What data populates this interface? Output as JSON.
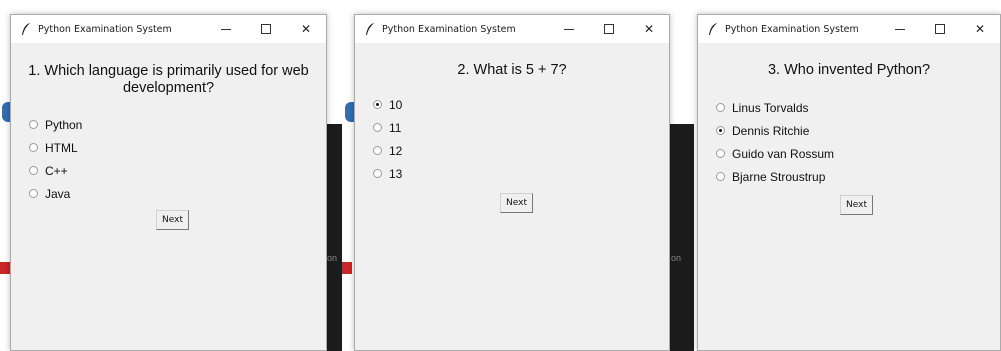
{
  "windows": [
    {
      "title": "Python Examination System",
      "question": "1. Which language is primarily used for web development?",
      "options": [
        {
          "label": "Python",
          "selected": false
        },
        {
          "label": "HTML",
          "selected": false
        },
        {
          "label": "C++",
          "selected": false
        },
        {
          "label": "Java",
          "selected": false
        }
      ],
      "next_label": "Next"
    },
    {
      "title": "Python Examination System",
      "question": "2. What is 5 + 7?",
      "options": [
        {
          "label": "10",
          "selected": true
        },
        {
          "label": "11",
          "selected": false
        },
        {
          "label": "12",
          "selected": false
        },
        {
          "label": "13",
          "selected": false
        }
      ],
      "next_label": "Next"
    },
    {
      "title": "Python Examination System",
      "question": "3. Who invented Python?",
      "options": [
        {
          "label": "Linus Torvalds",
          "selected": false
        },
        {
          "label": "Dennis Ritchie",
          "selected": true
        },
        {
          "label": "Guido van Rossum",
          "selected": false
        },
        {
          "label": "Bjarne Stroustrup",
          "selected": false
        }
      ],
      "next_label": "Next"
    }
  ],
  "controls": {
    "minimize": "—",
    "maximize": "☐",
    "close": "✕"
  },
  "background_fragments": {
    "left_label": "on",
    "middle_label": "on"
  },
  "colors": {
    "window_bg": "#f0f0f0",
    "titlebar_bg": "#ffffff",
    "desktop_dark": "#1c1c1c",
    "accent_blue": "#2e6fb5",
    "accent_red": "#c8262a"
  }
}
